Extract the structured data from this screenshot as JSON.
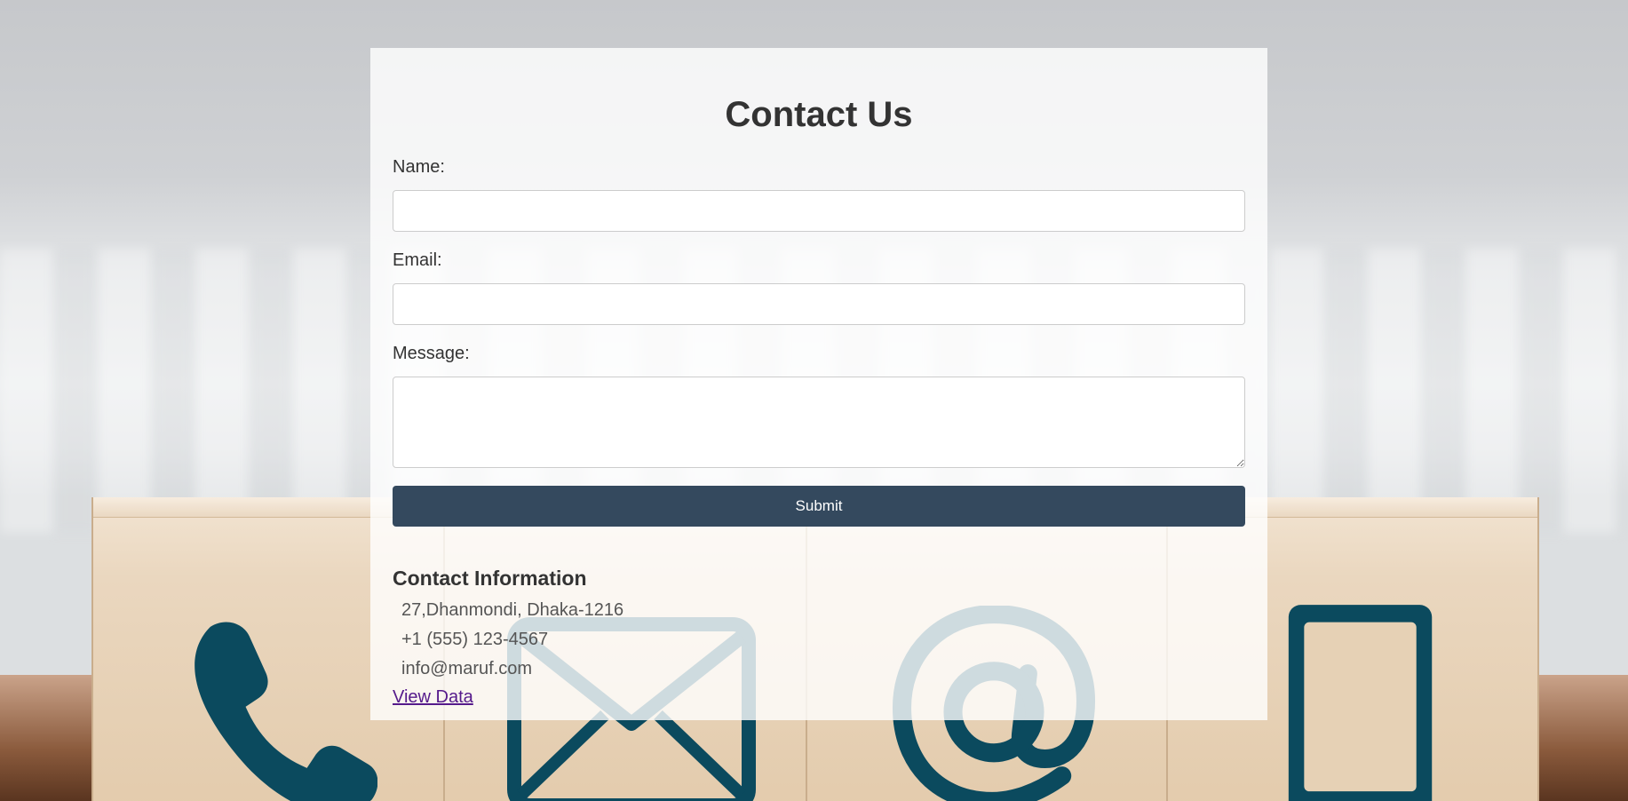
{
  "form": {
    "title": "Contact Us",
    "name_label": "Name:",
    "name_value": "",
    "email_label": "Email:",
    "email_value": "",
    "message_label": "Message:",
    "message_value": "",
    "submit_label": "Submit"
  },
  "contact_info": {
    "title": "Contact Information",
    "items": [
      "27,Dhanmondi, Dhaka-1216",
      "+1 (555) 123-4567",
      "info@maruf.com"
    ],
    "view_link": "View Data"
  },
  "background": {
    "icons": [
      "phone-icon",
      "mail-icon",
      "at-sign-icon",
      "mobile-icon"
    ],
    "icon_color": "#0b4a5e"
  },
  "colors": {
    "button": "#34495e",
    "card": "rgba(255,255,255,0.8)",
    "link_visited": "#551a8b"
  }
}
